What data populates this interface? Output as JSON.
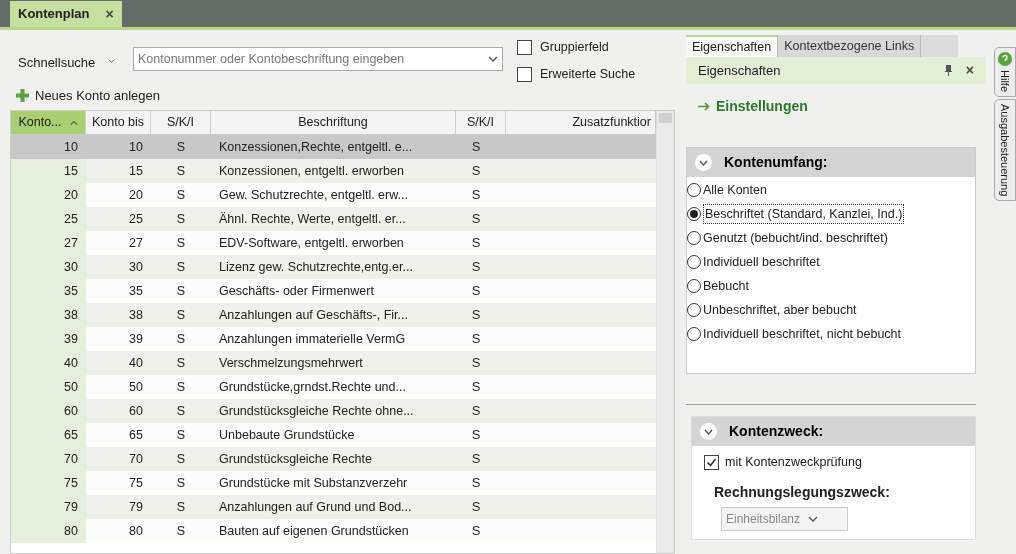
{
  "document_tab": {
    "title": "Kontenplan",
    "close": "×"
  },
  "search": {
    "label": "Schnellsuche",
    "placeholder": "Kontonummer oder Kontobeschriftung eingeben"
  },
  "options": [
    {
      "label": "Gruppierfeld",
      "checked": false
    },
    {
      "label": "Erweiterte Suche",
      "checked": false
    }
  ],
  "new_account": "Neues Konto anlegen",
  "table": {
    "columns": [
      {
        "label": "Konto...",
        "selected": true
      },
      {
        "label": "Konto bis",
        "selected": false
      },
      {
        "label": "S/K/I",
        "selected": false
      },
      {
        "label": "Beschriftung",
        "selected": false
      },
      {
        "label": "S/K/I",
        "selected": false
      },
      {
        "label": "Zusatzfunktior",
        "selected": false
      }
    ],
    "rows": [
      {
        "cells": [
          "10",
          "10",
          "S",
          "Konzessionen,Rechte, entgeltl. e...",
          "S"
        ],
        "selected": true
      },
      {
        "cells": [
          "15",
          "15",
          "S",
          "Konzessionen, entgeltl. erworben",
          "S"
        ],
        "selected": false
      },
      {
        "cells": [
          "20",
          "20",
          "S",
          "Gew. Schutzrechte, entgeltl. erw...",
          "S"
        ],
        "selected": false
      },
      {
        "cells": [
          "25",
          "25",
          "S",
          "Ähnl. Rechte, Werte, entgeltl. er...",
          "S"
        ],
        "selected": false
      },
      {
        "cells": [
          "27",
          "27",
          "S",
          "EDV-Software, entgeltl. erworben",
          "S"
        ],
        "selected": false
      },
      {
        "cells": [
          "30",
          "30",
          "S",
          "Lizenz gew. Schutzrechte,entg.er...",
          "S"
        ],
        "selected": false
      },
      {
        "cells": [
          "35",
          "35",
          "S",
          "Geschäfts- oder Firmenwert",
          "S"
        ],
        "selected": false
      },
      {
        "cells": [
          "38",
          "38",
          "S",
          "Anzahlungen auf Geschäfts-, Fir...",
          "S"
        ],
        "selected": false
      },
      {
        "cells": [
          "39",
          "39",
          "S",
          "Anzahlungen immaterielle VermG",
          "S"
        ],
        "selected": false
      },
      {
        "cells": [
          "40",
          "40",
          "S",
          "Verschmelzungsmehrwert",
          "S"
        ],
        "selected": false
      },
      {
        "cells": [
          "50",
          "50",
          "S",
          "Grundstücke,grndst.Rechte und...",
          "S"
        ],
        "selected": false
      },
      {
        "cells": [
          "60",
          "60",
          "S",
          "Grundstücksgleiche Rechte ohne...",
          "S"
        ],
        "selected": false
      },
      {
        "cells": [
          "65",
          "65",
          "S",
          "Unbebaute Grundstücke",
          "S"
        ],
        "selected": false
      },
      {
        "cells": [
          "70",
          "70",
          "S",
          "Grundstücksgleiche Rechte",
          "S"
        ],
        "selected": false
      },
      {
        "cells": [
          "75",
          "75",
          "S",
          "Grundstücke mit Substanzverzehr",
          "S"
        ],
        "selected": false
      },
      {
        "cells": [
          "79",
          "79",
          "S",
          "Anzahlungen auf Grund und Bod...",
          "S"
        ],
        "selected": false
      },
      {
        "cells": [
          "80",
          "80",
          "S",
          "Bauten auf eigenen Grundstücken",
          "S"
        ],
        "selected": false
      }
    ]
  },
  "panel_tabs": [
    {
      "label": "Eigenschaften",
      "selected": true
    },
    {
      "label": "Kontextbezogene Links",
      "selected": false
    }
  ],
  "panel": {
    "title": "Eigenschaften",
    "close": "×",
    "link": "Einstellungen"
  },
  "scope": {
    "title": "Kontenumfang:",
    "expanded": true,
    "options": [
      {
        "label": "Alle Konten",
        "selected": false
      },
      {
        "label": "Beschriftet (Standard, Kanzlei, Ind.)",
        "selected": true
      },
      {
        "label": "Genutzt (bebucht/ind. beschriftet)",
        "selected": false
      },
      {
        "label": "Individuell beschriftet",
        "selected": false
      },
      {
        "label": "Bebucht",
        "selected": false
      },
      {
        "label": "Unbeschriftet, aber bebucht",
        "selected": false
      },
      {
        "label": "Individuell beschriftet, nicht bebucht",
        "selected": false
      }
    ]
  },
  "purpose": {
    "title": "Kontenzweck:",
    "expanded": true,
    "check": {
      "label": "mit Kontenzweckprüfung",
      "checked": true
    },
    "label": "Rechnungslegungszweck:",
    "value": "Einheitsbilanz"
  },
  "side_tabs": [
    {
      "label": "Hilfe",
      "selected": false
    },
    {
      "label": "Ausgabesteuerung",
      "selected": false
    }
  ]
}
